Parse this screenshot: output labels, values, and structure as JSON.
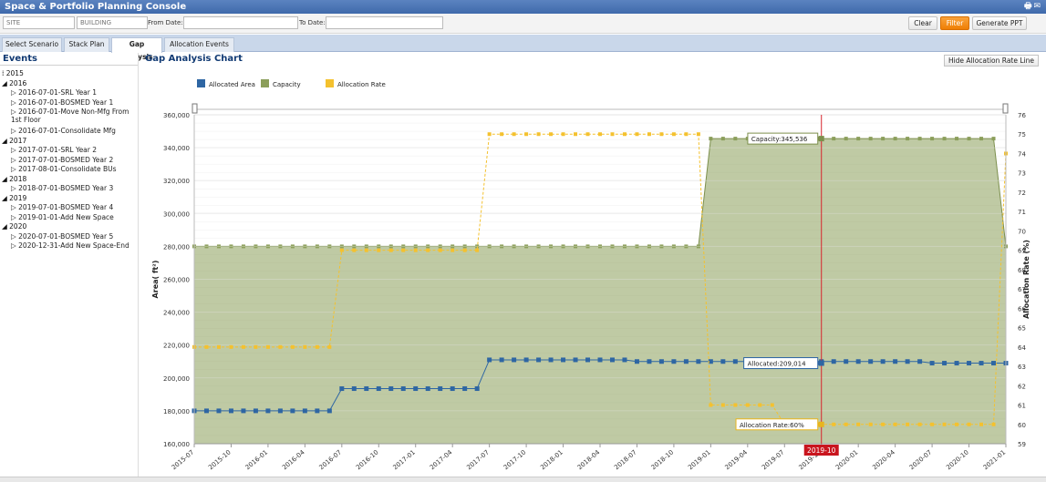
{
  "app": {
    "title": "Space & Portfolio Planning Console"
  },
  "filters": {
    "site_placeholder": "SITE",
    "building_placeholder": "BUILDING",
    "from_label": "From Date:",
    "to_label": "To Date:",
    "clear_label": "Clear",
    "filter_label": "Filter",
    "ppt_label": "Generate PPT"
  },
  "tabs": [
    "Select Scenario",
    "Stack Plan",
    "Gap Analysis",
    "Allocation Events"
  ],
  "events": {
    "title": "Events",
    "years": [
      {
        "year": "2015",
        "items": []
      },
      {
        "year": "2016",
        "items": [
          "2016-07-01-SRL Year 1",
          "2016-07-01-BOSMED Year 1",
          "2016-07-01-Move Non-Mfg From 1st Floor",
          "2016-07-01-Consolidate Mfg"
        ]
      },
      {
        "year": "2017",
        "items": [
          "2017-07-01-SRL Year 2",
          "2017-07-01-BOSMED Year 2",
          "2017-08-01-Consolidate BUs"
        ]
      },
      {
        "year": "2018",
        "items": [
          "2018-07-01-BOSMED Year 3"
        ]
      },
      {
        "year": "2019",
        "items": [
          "2019-07-01-BOSMED Year 4",
          "2019-01-01-Add New Space"
        ]
      },
      {
        "year": "2020",
        "items": [
          "2020-07-01-BOSMED Year 5",
          "2020-12-31-Add New Space-End"
        ]
      }
    ]
  },
  "chart_panel": {
    "title": "Gap Analysis Chart",
    "hide_button": "Hide Allocation Rate Line"
  },
  "chart_data": {
    "type": "line",
    "title": "",
    "ylabel": "Area( ft²)",
    "y2label": "Allocation Rate (%)",
    "ylim": [
      160000,
      360000
    ],
    "yticks": [
      "160,000",
      "180,000",
      "200,000",
      "220,000",
      "240,000",
      "260,000",
      "280,000",
      "300,000",
      "320,000",
      "340,000",
      "360,000"
    ],
    "y2lim": [
      59,
      76
    ],
    "y2ticks": [
      "59",
      "60",
      "61",
      "62",
      "63",
      "64",
      "65",
      "66",
      "67",
      "68",
      "69",
      "70",
      "71",
      "72",
      "73",
      "74",
      "75",
      "76"
    ],
    "xrange": [
      "2015-07",
      "2021-01"
    ],
    "xticks": [
      "2015-07",
      "2015-10",
      "2016-01",
      "2016-04",
      "2016-07",
      "2016-10",
      "2017-01",
      "2017-04",
      "2017-07",
      "2017-10",
      "2018-01",
      "2018-04",
      "2018-07",
      "2018-10",
      "2019-01",
      "2019-04",
      "2019-07",
      "2019-10",
      "2020-01",
      "2020-04",
      "2020-07",
      "2020-10",
      "2021-01"
    ],
    "legend": [
      {
        "name": "Allocated Area",
        "color": "#2e66a3"
      },
      {
        "name": "Capacity",
        "color": "#8b9e5a"
      },
      {
        "name": "Allocation Rate",
        "color": "#f4c12e"
      }
    ],
    "legend_position": "top-left",
    "series": [
      {
        "name": "Capacity",
        "type": "area",
        "color": "#8b9e5a",
        "steps": [
          [
            "2015-07",
            280000
          ],
          [
            "2018-12",
            280000
          ],
          [
            "2019-01",
            345536
          ],
          [
            "2020-12",
            345536
          ],
          [
            "2021-01",
            280000
          ]
        ]
      },
      {
        "name": "Allocated Area",
        "type": "line",
        "color": "#2e66a3",
        "steps": [
          [
            "2015-07",
            180000
          ],
          [
            "2016-06",
            180000
          ],
          [
            "2016-07",
            193500
          ],
          [
            "2017-06",
            193500
          ],
          [
            "2017-07",
            211000
          ],
          [
            "2018-06",
            211000
          ],
          [
            "2018-07",
            210000
          ],
          [
            "2020-06",
            210000
          ],
          [
            "2020-07",
            209000
          ],
          [
            "2021-01",
            209000
          ]
        ]
      },
      {
        "name": "Allocation Rate",
        "type": "line",
        "color": "#f4c12e",
        "dashed": true,
        "points": [
          [
            "2015-07",
            64
          ],
          [
            "2016-06",
            64
          ],
          [
            "2016-07",
            69
          ],
          [
            "2017-06",
            69
          ],
          [
            "2017-07",
            75
          ],
          [
            "2018-12",
            75
          ],
          [
            "2019-01",
            61
          ],
          [
            "2019-06",
            61
          ],
          [
            "2019-07",
            60
          ],
          [
            "2020-12",
            60
          ],
          [
            "2021-01",
            74
          ]
        ]
      }
    ],
    "crosshair": {
      "x": "2019-10",
      "label": "2019-10"
    },
    "tooltips": {
      "capacity": "Capacity:345,536",
      "allocated": "Allocated:209,014",
      "rate": "Allocation Rate:60%"
    },
    "grid": true
  }
}
